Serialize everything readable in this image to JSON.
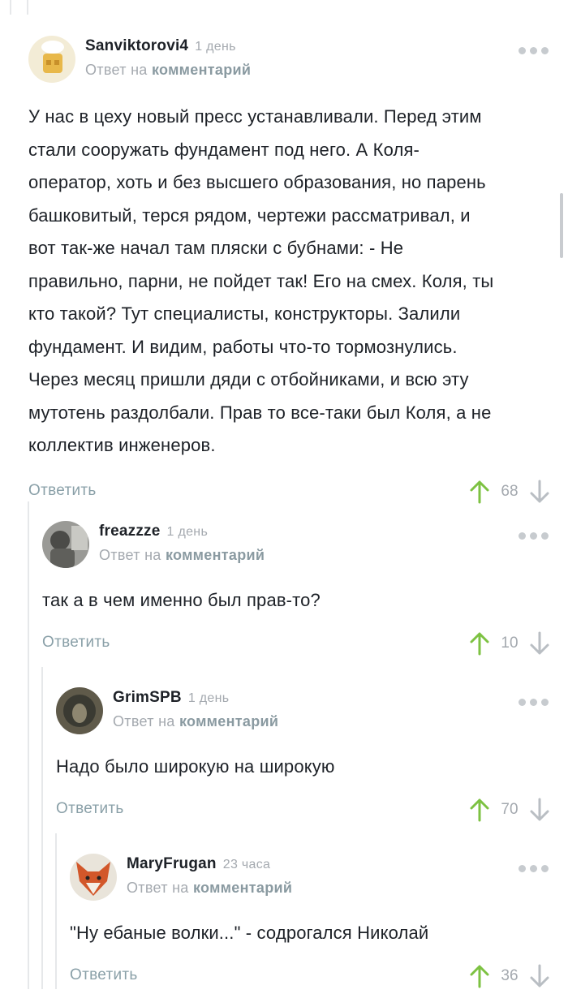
{
  "comments": [
    {
      "username": "Sanviktorovi4",
      "time": "1 день",
      "reply_prefix": "Ответ на",
      "reply_link": "комментарий",
      "body_lines": [
        "У нас в цеху новый пресс устанавливали. Перед этим",
        "стали сооружать фундамент под него. А Коля-",
        "оператор, хоть и без высшего образования, но парень",
        "башковитый, терся рядом, чертежи рассматривал, и",
        "вот так-же начал там пляски с бубнами: - Не",
        "правильно, парни, не пойдет так! Его на смех. Коля, ты",
        "кто такой? Тут специалисты, конструкторы. Залили",
        "фундамент. И видим, работы что-то тормознулись.",
        "Через месяц пришли дяди с отбойниками, и всю эту",
        "мутотень раздолбали. Прав то все-таки был Коля, а не",
        "коллектив инженеров."
      ],
      "reply_label": "Ответить",
      "rating": "68"
    },
    {
      "username": "freazzze",
      "time": "1 день",
      "reply_prefix": "Ответ на",
      "reply_link": "комментарий",
      "body_lines": [
        "так а в чем именно был прав-то?"
      ],
      "reply_label": "Ответить",
      "rating": "10"
    },
    {
      "username": "GrimSPB",
      "time": "1 день",
      "reply_prefix": "Ответ на",
      "reply_link": "комментарий",
      "body_lines": [
        "Надо было широкую на широкую"
      ],
      "reply_label": "Ответить",
      "rating": "70"
    },
    {
      "username": "MaryFrugan",
      "time": "23 часа",
      "reply_prefix": "Ответ на",
      "reply_link": "комментарий",
      "body_lines": [
        "\"Ну ебаные волки...\" - содрогался Николай"
      ],
      "reply_label": "Ответить",
      "rating": "36"
    }
  ],
  "colors": {
    "upvote": "#7dc242",
    "downvote": "#b9bec3",
    "username": "#1d2127",
    "muted": "#a4a9af",
    "reply_link": "#8aa0a8"
  },
  "icons": [
    "more-icon",
    "upvote-arrow-icon",
    "downvote-arrow-icon"
  ]
}
